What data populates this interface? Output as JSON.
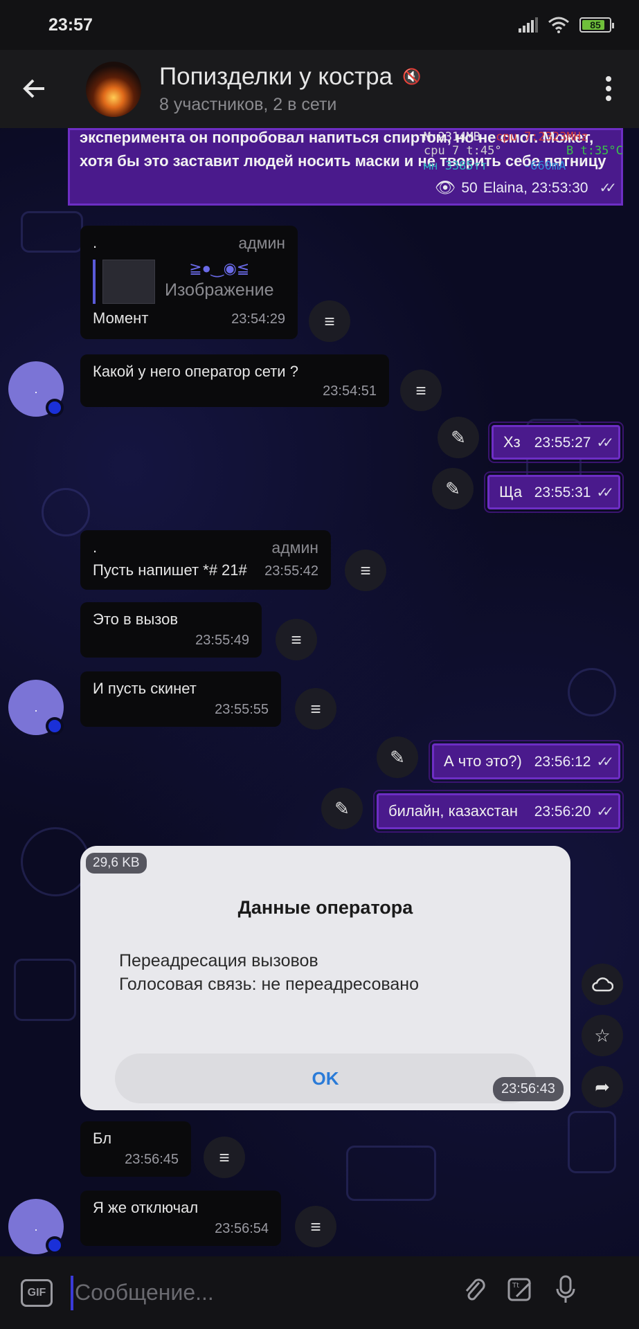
{
  "status_bar": {
    "time": "23:57",
    "battery": "85",
    "battery_level": 0.85
  },
  "header": {
    "title": "Попизделки у костра",
    "subtitle": "8 участников, 2 в сети"
  },
  "overlay": {
    "mem": "M:2314MB",
    "cpu_freq": "cpu 7:2323MHz",
    "cpu_temp": "cpu 7 t:45°",
    "bat_temp": "B t:35°C",
    "current": "-660mA",
    "misc": "мн 3385тт"
  },
  "messages": {
    "m0": {
      "text": "эксперимента он попробовал напиться спиртом, но не смог. Может, хотя бы это заставит людей носить маски и не творить себе пятницу",
      "views": "50",
      "author_time": "Elaina, 23:53:30"
    },
    "m1": {
      "sender": ".",
      "tag": "админ",
      "reply_label": "Изображение",
      "reply_emoji": "≧●‿◉≦",
      "text": "Момент",
      "time": "23:54:29"
    },
    "m2": {
      "text": "Какой у него оператор сети ?",
      "time": "23:54:51",
      "avatar_letter": "."
    },
    "m3": {
      "text": "Хз",
      "time": "23:55:27"
    },
    "m4": {
      "text": "Ща",
      "time": "23:55:31"
    },
    "m5": {
      "sender": ".",
      "tag": "админ",
      "text": "Пусть напишет *# 21#",
      "time": "23:55:42"
    },
    "m6": {
      "text": "Это в вызов",
      "time": "23:55:49"
    },
    "m7": {
      "text": "И пусть скинет",
      "time": "23:55:55",
      "avatar_letter": "."
    },
    "m8": {
      "text": "А что это?)",
      "time": "23:56:12"
    },
    "m9": {
      "text": "билайн, казахстан",
      "time": "23:56:20"
    },
    "photo": {
      "size": "29,6 KB",
      "time": "23:56:43",
      "dialog_title": "Данные оператора",
      "line1": "Переадресация вызовов",
      "line2": "Голосовая связь: не переадресовано",
      "ok": "OK"
    },
    "m10": {
      "text": "Бл",
      "time": "23:56:45"
    },
    "m11": {
      "text": "Я же отключал",
      "time": "23:56:54",
      "avatar_letter": "."
    }
  },
  "input": {
    "gif_label": "GIF",
    "placeholder": "Сообщение..."
  }
}
